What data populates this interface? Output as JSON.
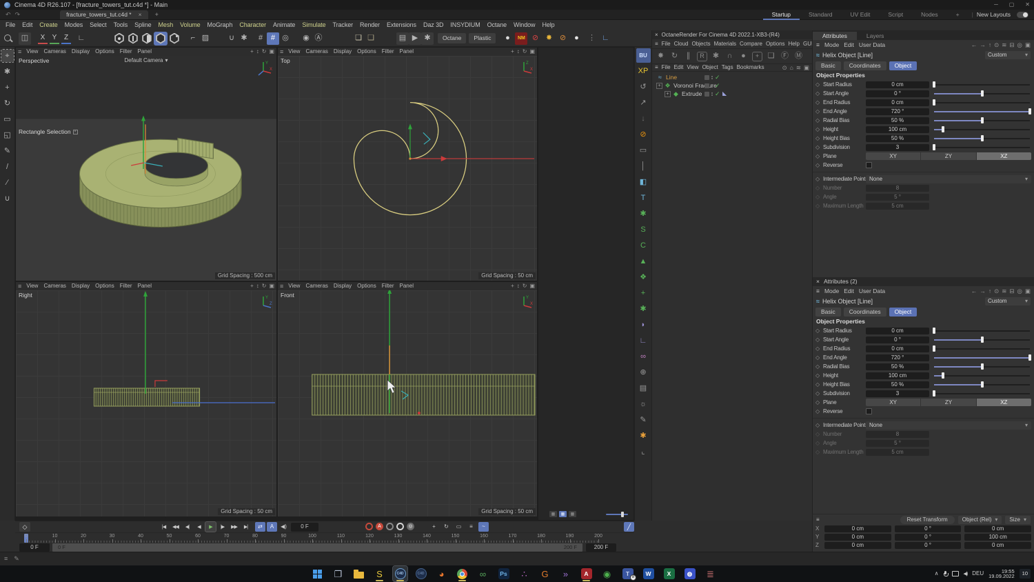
{
  "window": {
    "title": "Cinema 4D R26.107 - [fracture_towers_tut.c4d *] - Main"
  },
  "tab_bar": {
    "document_tab": "fracture_towers_tut.c4d *",
    "close_icon": "×",
    "add_icon": "+",
    "layout_tabs": [
      "Startup",
      "Standard",
      "UV Edit",
      "Script",
      "Nodes"
    ],
    "active_layout": "Startup",
    "new_layouts": "New Layouts"
  },
  "menu_bar": {
    "items": [
      "File",
      "Edit",
      "Create",
      "Modes",
      "Select",
      "Tools",
      "Spline",
      "Mesh",
      "Volume",
      "MoGraph",
      "Character",
      "Animate",
      "Simulate",
      "Tracker",
      "Render",
      "Extensions",
      "Daz 3D",
      "INSYDIUM",
      "Octane",
      "Window",
      "Help"
    ],
    "highlighted": [
      "Create",
      "Mesh",
      "Volume",
      "Character",
      "Simulate"
    ]
  },
  "toolbar": {
    "render_preset": "Octane",
    "material_preset": "Plastic",
    "items": [
      {
        "kind": "glyph",
        "name": "move-tool-box-icon",
        "glyph": "◫",
        "box": true,
        "ml": 6
      },
      {
        "kind": "axis",
        "name": "x-axis-lock",
        "glyph": "X",
        "underline": "#c84b4b",
        "ml": 10
      },
      {
        "kind": "axis",
        "name": "y-axis-lock",
        "glyph": "Y",
        "underline": "#58a658",
        "ml": 3
      },
      {
        "kind": "axis",
        "name": "z-axis-lock",
        "glyph": "Z",
        "underline": "#4b74c8",
        "ml": 3
      },
      {
        "kind": "glyph",
        "name": "coordinate-system-icon",
        "glyph": "∟",
        "ml": 6
      },
      {
        "kind": "hex",
        "name": "points-mode-icon",
        "inner": "dot",
        "ml": 36
      },
      {
        "kind": "hex",
        "name": "edges-mode-icon",
        "inner": "line"
      },
      {
        "kind": "hex",
        "name": "polygons-mode-icon",
        "inner": "half"
      },
      {
        "kind": "hex",
        "name": "model-mode-icon",
        "inner": "fill",
        "active": true
      },
      {
        "kind": "hex",
        "name": "texture-mode-icon",
        "inner": "spark"
      },
      {
        "kind": "glyph",
        "name": "workplane-icon",
        "glyph": "⌐",
        "ml": 8
      },
      {
        "kind": "glyph",
        "name": "texture-axis-icon",
        "glyph": "▨"
      },
      {
        "kind": "glyph",
        "name": "snap-icon",
        "glyph": "∪",
        "ml": 20
      },
      {
        "kind": "glyph",
        "name": "snap-settings-icon",
        "glyph": "✱"
      },
      {
        "kind": "glyph",
        "name": "grid-quantize-icon",
        "glyph": "#",
        "ml": 6
      },
      {
        "kind": "glyph",
        "name": "grid-quantize-active-icon",
        "glyph": "#",
        "active": true
      },
      {
        "kind": "glyph",
        "name": "workplane-mode-icon",
        "glyph": "◎"
      },
      {
        "kind": "glyph",
        "name": "viewport-solo-icon",
        "glyph": "◉",
        "ml": 12
      },
      {
        "kind": "glyph",
        "name": "axis-modify-icon",
        "glyph": "Ⓐ"
      },
      {
        "kind": "glyph",
        "name": "cube-white-icon",
        "glyph": "❏",
        "color": "#cfc8ae",
        "ml": 40
      },
      {
        "kind": "glyph",
        "name": "cube-shaded-icon",
        "glyph": "❏",
        "color": "#a89f82"
      },
      {
        "kind": "glyph",
        "name": "render-view-icon",
        "glyph": "▤",
        "box": true,
        "ml": 28
      },
      {
        "kind": "glyph",
        "name": "render-picture-icon",
        "glyph": "▶",
        "box": true
      },
      {
        "kind": "glyph",
        "name": "render-settings-icon",
        "glyph": "✱",
        "box": true
      },
      {
        "kind": "button",
        "name": "render-preset-button",
        "bindkey": "render_preset",
        "ml": 6
      },
      {
        "kind": "button",
        "name": "material-preset-button",
        "bindkey": "material_preset",
        "ml": 4
      },
      {
        "kind": "glyph",
        "name": "material-sphere-icon",
        "glyph": "●",
        "color": "#dcdcdc",
        "ml": 8
      },
      {
        "kind": "badge",
        "name": "nm-material-icon",
        "glyph": "NM",
        "color": "#f0c420",
        "bg": "#7a1d1d",
        "ml": 2
      },
      {
        "kind": "glyph",
        "name": "no-material-icon",
        "glyph": "⊘",
        "color": "#d94444",
        "ml": 2
      },
      {
        "kind": "glyph",
        "name": "octane-fan-icon",
        "glyph": "✸",
        "color": "#e8b53a",
        "ml": 2
      },
      {
        "kind": "glyph",
        "name": "octane-disabled-icon",
        "glyph": "⊘",
        "color": "#d98a3a",
        "ml": 2
      },
      {
        "kind": "glyph",
        "name": "material-sphere2-icon",
        "glyph": "●",
        "color": "#e5e5e5",
        "ml": 2
      },
      {
        "kind": "glyph",
        "name": "more-dots-icon",
        "glyph": "⋮",
        "color": "#8a8a8a",
        "ml": 4
      },
      {
        "kind": "glyph",
        "name": "axis-locate-icon",
        "glyph": "∟",
        "color": "#6fa0e0",
        "ml": 2
      }
    ]
  },
  "left_tools": [
    {
      "name": "live-selection-tool",
      "glyph": "⌖",
      "active": true
    },
    {
      "name": "tweak-tool-icon",
      "glyph": "✱"
    },
    {
      "name": "move-tool-icon",
      "glyph": "+"
    },
    {
      "name": "rotate-tool-icon",
      "glyph": "↻"
    },
    {
      "name": "scale-tool-icon",
      "glyph": "▭"
    },
    {
      "name": "frame-tool-icon",
      "glyph": "◱"
    },
    {
      "name": "pen-tool-icon",
      "glyph": "✎"
    },
    {
      "name": "brush-tool-icon",
      "glyph": "/"
    },
    {
      "name": "knife-tool-icon",
      "glyph": "∕"
    },
    {
      "name": "magnet-tool-icon",
      "glyph": "∪"
    }
  ],
  "viewports": {
    "menu": [
      "View",
      "Cameras",
      "Display",
      "Options",
      "Filter",
      "Panel"
    ],
    "corner_tools": [
      {
        "name": "pan-icon",
        "glyph": "+"
      },
      {
        "name": "zoom-icon",
        "glyph": "↕"
      },
      {
        "name": "rotate-icon",
        "glyph": "↻"
      },
      {
        "name": "maximize-icon",
        "glyph": "▣"
      }
    ],
    "perspective": {
      "label": "Perspective",
      "camera": "Default Camera",
      "tool": "Rectangle Selection",
      "grid": "Grid Spacing : 500 cm",
      "axis_up": "Y",
      "axis_right": "X"
    },
    "top": {
      "label": "Top",
      "grid": "Grid Spacing : 50 cm",
      "axis_up": "Z",
      "axis_right": "X"
    },
    "right": {
      "label": "Right",
      "grid": "Grid Spacing : 50 cm",
      "axis_up": "Y",
      "axis_right": "Z"
    },
    "front": {
      "label": "Front",
      "grid": "Grid Spacing : 50 cm",
      "axis_up": "Y",
      "axis_right": "X"
    }
  },
  "octane": {
    "title": "OctaneRender For Cinema 4D 2022.1-XB3-(R4)",
    "close_icon": "×",
    "menu": [
      "File",
      "Cloud",
      "Objects",
      "Materials",
      "Compare",
      "Options",
      "Help",
      "GUI"
    ],
    "icons": [
      {
        "name": "octane-restart-icon",
        "glyph": "✸"
      },
      {
        "name": "octane-refresh-icon",
        "glyph": "↻"
      },
      {
        "name": "octane-pause-icon",
        "glyph": "∥"
      },
      {
        "name": "octane-region-icon",
        "glyph": "R",
        "boxed": true
      },
      {
        "name": "octane-settings-icon",
        "glyph": "✱"
      },
      {
        "name": "octane-lock-icon",
        "glyph": "∩"
      },
      {
        "name": "octane-material-icon",
        "glyph": "●"
      },
      {
        "name": "octane-add-icon",
        "glyph": "+",
        "boxed": true
      },
      {
        "name": "octane-window-icon",
        "glyph": "❏"
      },
      {
        "name": "octane-camera-f-icon",
        "glyph": "Ⓕ"
      },
      {
        "name": "octane-camera-m-icon",
        "glyph": "Ⓜ"
      }
    ]
  },
  "object_manager": {
    "menu": [
      "File",
      "Edit",
      "View",
      "Object",
      "Tags",
      "Bookmarks"
    ],
    "nav_icons": [
      {
        "name": "search-icon",
        "glyph": "⊙"
      },
      {
        "name": "home-icon",
        "glyph": "⌂"
      },
      {
        "name": "filter-icon",
        "glyph": "≋"
      },
      {
        "name": "new-window-icon",
        "glyph": "▣"
      }
    ],
    "objects": [
      {
        "name": "Line",
        "icon": "spline",
        "icon_glyph": "≈",
        "icon_color": "#6fb0d0",
        "text_color": "#d79e43",
        "expand": false,
        "indent": 0
      },
      {
        "name": "Voronoi Fracture",
        "icon": "voronoi",
        "icon_glyph": "❖",
        "icon_color": "#54b154",
        "expand": true,
        "indent": 0
      },
      {
        "name": "Extrude",
        "icon": "extrude",
        "icon_glyph": "◆",
        "icon_color": "#54b154",
        "expand": true,
        "indent": 1,
        "tag": "polygon-selection-tag"
      }
    ]
  },
  "attributes": {
    "tab_attributes": "Attributes",
    "tab_layers": "Layers",
    "panel2_title": "Attributes (2)",
    "close_icon": "×",
    "menu": [
      "Mode",
      "Edit",
      "User Data"
    ],
    "nav_icons": [
      {
        "name": "back-arrow-icon",
        "glyph": "←"
      },
      {
        "name": "forward-arrow-icon",
        "glyph": "→"
      },
      {
        "name": "up-arrow-icon",
        "glyph": "↑"
      },
      {
        "name": "search-icon",
        "glyph": "⊙"
      },
      {
        "name": "filter-icon",
        "glyph": "≋"
      },
      {
        "name": "lock-icon",
        "glyph": "⊟"
      },
      {
        "name": "target-icon",
        "glyph": "◎"
      },
      {
        "name": "new-window-icon",
        "glyph": "▣"
      }
    ],
    "object_title": "Helix Object [Line]",
    "preset": "Custom",
    "tabs": [
      "Basic",
      "Coordinates",
      "Object"
    ],
    "active_tab": "Object",
    "section": "Object Properties",
    "props": [
      {
        "label": "Start Radius",
        "value": "0 cm",
        "slider": 0.01
      },
      {
        "label": "Start Angle",
        "value": "0 °",
        "slider": 0.5
      },
      {
        "label": "End Radius",
        "value": "0 cm",
        "slider": 0.01
      },
      {
        "label": "End Angle",
        "value": "720 °",
        "slider": 0.99
      },
      {
        "label": "Radial Bias",
        "value": "50 %",
        "slider": 0.5
      },
      {
        "label": "Height",
        "value": "100 cm",
        "slider": 0.1
      },
      {
        "label": "Height Bias",
        "value": "50 %",
        "slider": 0.5
      },
      {
        "label": "Subdivision",
        "value": "3",
        "slider": 0.01
      }
    ],
    "plane": {
      "label": "Plane",
      "options": [
        "XY",
        "ZY",
        "XZ"
      ],
      "selected": "XZ"
    },
    "reverse_label": "Reverse",
    "intermediate": {
      "label": "Intermediate Points",
      "value": "None"
    },
    "disabled_props": [
      {
        "label": "Number",
        "value": "8"
      },
      {
        "label": "Angle",
        "value": "5 °"
      },
      {
        "label": "Maximum Length",
        "value": "5 cm"
      }
    ]
  },
  "coordinates": {
    "reset": "Reset Transform",
    "mode": "Object (Rel)",
    "size": "Size",
    "rows": [
      {
        "axis": "X",
        "pos": "0 cm",
        "rot": "0 °",
        "scale": "0 cm"
      },
      {
        "axis": "Y",
        "pos": "0 cm",
        "rot": "0 °",
        "scale": "100 cm"
      },
      {
        "axis": "Z",
        "pos": "0 cm",
        "rot": "0 °",
        "scale": "0 cm"
      }
    ]
  },
  "timeline": {
    "current": "0 F",
    "range_start": "0 F",
    "range_end": "200 F",
    "bar_start": "0 F",
    "bar_end": "200 F",
    "ticks": [
      0,
      10,
      20,
      30,
      40,
      50,
      60,
      70,
      80,
      90,
      100,
      110,
      120,
      130,
      140,
      150,
      160,
      170,
      180,
      190,
      200
    ],
    "transport": [
      {
        "name": "goto-start-button",
        "glyph": "|◀"
      },
      {
        "name": "prev-key-button",
        "glyph": "◀◀"
      },
      {
        "name": "prev-frame-button",
        "glyph": "◀|"
      },
      {
        "name": "play-backward-button",
        "glyph": "◀"
      },
      {
        "name": "play-forward-button",
        "glyph": "▶",
        "active": true
      },
      {
        "name": "next-frame-button",
        "glyph": "|▶"
      },
      {
        "name": "next-key-button",
        "glyph": "▶▶"
      },
      {
        "name": "goto-end-button",
        "glyph": "▶|"
      }
    ],
    "toggles": [
      {
        "name": "loop-toggle",
        "glyph": "⇄",
        "active": true
      },
      {
        "name": "autokey-range-toggle",
        "glyph": "A",
        "active": true
      },
      {
        "name": "sound-toggle",
        "glyph": "◀)"
      }
    ],
    "record_icons": [
      {
        "name": "record-keyframe-button",
        "kind": "ring",
        "color": "#c64a3c"
      },
      {
        "name": "autokey-button",
        "kind": "disc",
        "glyph": "A",
        "color": "#c64a3c"
      },
      {
        "name": "keyframe-selection-button",
        "kind": "ring",
        "color": "#8a8a8a"
      },
      {
        "name": "record-objects-button",
        "kind": "ring",
        "color": "#d5d5d5"
      },
      {
        "name": "keyframe-presets-button",
        "kind": "disc",
        "glyph": "◎",
        "color": "#6a6a6a"
      }
    ],
    "key_toggles": [
      {
        "name": "record-position-toggle",
        "glyph": "+"
      },
      {
        "name": "record-rotation-toggle",
        "glyph": "↻"
      },
      {
        "name": "record-scale-toggle",
        "glyph": "▭"
      },
      {
        "name": "record-parameter-toggle",
        "glyph": "≡"
      },
      {
        "name": "record-pla-toggle",
        "glyph": "~",
        "active": true
      }
    ],
    "curve_icon": {
      "name": "timeline-curve-button",
      "glyph": "╱"
    }
  },
  "statusbar": {
    "icons": [
      {
        "name": "menu-icon",
        "glyph": "≡"
      },
      {
        "name": "edit-icon",
        "glyph": "✎"
      }
    ]
  },
  "taskbar": {
    "apps": [
      {
        "name": "start-button",
        "kind": "win"
      },
      {
        "name": "task-view-button",
        "kind": "glyph",
        "glyph": "❐",
        "color": "#b8c4d8"
      },
      {
        "name": "file-explorer-app",
        "kind": "folder"
      },
      {
        "name": "sublime-app",
        "kind": "glyph",
        "glyph": "S",
        "color": "#e8c93d",
        "running": true
      },
      {
        "name": "cinema4d-app",
        "kind": "c4d",
        "label": "C4D",
        "active": true,
        "running": true
      },
      {
        "name": "cinema4d-alt-app",
        "kind": "c4d2",
        "label": "C4D"
      },
      {
        "name": "firefox-app",
        "kind": "glyph",
        "glyph": "◕",
        "color": "#e8762d"
      },
      {
        "name": "chrome-app",
        "kind": "chrome",
        "running": true
      },
      {
        "name": "swirl-app",
        "kind": "glyph",
        "glyph": "∞",
        "color": "#58a65c"
      },
      {
        "name": "photoshop-app",
        "kind": "badge",
        "glyph": "Ps",
        "color": "#6fb3e8",
        "bg": "#10243f"
      },
      {
        "name": "nodes-app",
        "kind": "glyph",
        "glyph": "∴",
        "color": "#c76fd0"
      },
      {
        "name": "g-shield-app",
        "kind": "glyph",
        "glyph": "G",
        "color": "#e07b2d"
      },
      {
        "name": "arrows-app",
        "kind": "glyph",
        "glyph": "»",
        "color": "#9a6fd0"
      },
      {
        "name": "autocad-app",
        "kind": "badge",
        "glyph": "A",
        "color": "#ffffff",
        "bg": "#a3262c",
        "running": true
      },
      {
        "name": "lime-app",
        "kind": "glyph",
        "glyph": "◉",
        "color": "#4db14d"
      },
      {
        "name": "teams-app",
        "kind": "badge",
        "glyph": "T",
        "color": "#cdd8f0",
        "bg": "#3a55a0",
        "count": "8"
      },
      {
        "name": "word-app",
        "kind": "badge",
        "glyph": "W",
        "color": "#ffffff",
        "bg": "#1f4fa0"
      },
      {
        "name": "excel-app",
        "kind": "badge",
        "glyph": "X",
        "color": "#ffffff",
        "bg": "#1a6e42"
      },
      {
        "name": "discord-app",
        "kind": "badge",
        "glyph": "◍",
        "color": "#ffffff",
        "bg": "#3a52c8"
      },
      {
        "name": "stripes-app",
        "kind": "glyph",
        "glyph": "≣",
        "color": "#c76f6f"
      }
    ],
    "lang": "DEU",
    "time": "19:55",
    "date": "19.09.2022",
    "notif": "10"
  },
  "plugin_bar": [
    {
      "name": "bullet-bu-icon",
      "glyph": "BU",
      "color": "#cfe0ff",
      "bg": "#4a5f94"
    },
    {
      "name": "xparticles-icon",
      "glyph": "XP",
      "color": "#e8c431"
    },
    {
      "name": "undo-arrow-icon",
      "glyph": "↺",
      "color": "#9a9a9a"
    },
    {
      "name": "export-arrow-icon",
      "glyph": "↗",
      "color": "#9a9a9a"
    },
    {
      "name": "import-arrow-icon",
      "glyph": "↓",
      "color": "#6f6f6f"
    },
    {
      "name": "no-entry-icon",
      "glyph": "⊘",
      "color": "#e8920e"
    },
    {
      "name": "rectangle-icon",
      "glyph": "▭",
      "color": "#9a9a9a"
    },
    {
      "name": "line-tool-icon",
      "glyph": "│",
      "color": "#9a9a9a"
    },
    {
      "name": "cube-icon",
      "glyph": "◧",
      "color": "#6fb6d9"
    },
    {
      "name": "text-tool-icon",
      "glyph": "T",
      "color": "#6fb6d9"
    },
    {
      "name": "emitter-icon",
      "glyph": "✱",
      "color": "#58b158"
    },
    {
      "name": "spline-green-icon",
      "glyph": "S",
      "color": "#58b158"
    },
    {
      "name": "bird-icon",
      "glyph": "C",
      "color": "#58b158"
    },
    {
      "name": "triangle-icon",
      "glyph": "▲",
      "color": "#58b158"
    },
    {
      "name": "cluster-icon",
      "glyph": "❖",
      "color": "#58b158"
    },
    {
      "name": "block-icon",
      "glyph": "+",
      "color": "#58b158"
    },
    {
      "name": "gear-green-icon",
      "glyph": "✱",
      "color": "#58b158"
    },
    {
      "name": "bean-icon",
      "glyph": "◗",
      "color": "#9a8fd0"
    },
    {
      "name": "axis-icon",
      "glyph": "∟",
      "color": "#9a8fd0"
    },
    {
      "name": "ribbon-icon",
      "glyph": "∞",
      "color": "#c080c0"
    },
    {
      "name": "globe-icon",
      "glyph": "⊕",
      "color": "#9a9a9a"
    },
    {
      "name": "projector-icon",
      "glyph": "▤",
      "color": "#9a9a9a"
    },
    {
      "name": "bulb-icon",
      "glyph": "☼",
      "color": "#9a9a9a"
    },
    {
      "name": "hex-pencil-icon",
      "glyph": "✎",
      "color": "#9a9a9a"
    },
    {
      "name": "asterisk-icon",
      "glyph": "✱",
      "color": "#e8a03a"
    },
    {
      "name": "xlo-icon",
      "glyph": "⌞",
      "color": "#9a9a9a"
    }
  ]
}
